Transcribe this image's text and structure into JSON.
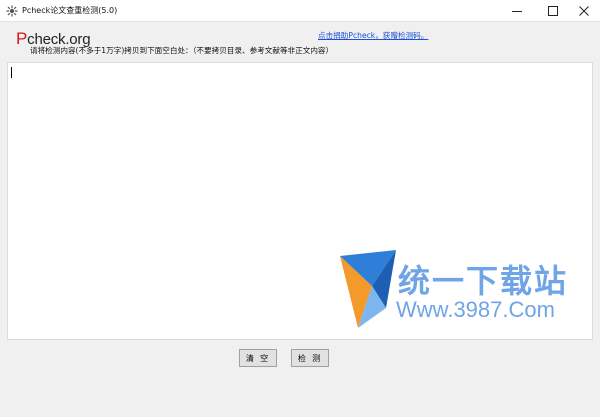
{
  "window": {
    "title": "Pcheck论文查重检测(5.0)",
    "controls": {
      "minimize": "—",
      "maximize": "☐",
      "close": "✕"
    }
  },
  "header": {
    "logo_initial": "P",
    "logo_rest": "check.org",
    "donate_link": "点击捐助Pcheck，获赠检测码。",
    "instruction": "请将检测内容(不多于1万字)拷贝到下面空白处：（不要拷贝目录、参考文献等非正文内容）"
  },
  "editor": {
    "value": ""
  },
  "watermark": {
    "title": "统一下载站",
    "url": "Www.3987.Com"
  },
  "buttons": {
    "clear_label": "清 空",
    "check_label": "检 测"
  },
  "colors": {
    "logo_accent": "#d8141b",
    "link": "#1c4fd6",
    "watermark": "#6fa4e6"
  }
}
